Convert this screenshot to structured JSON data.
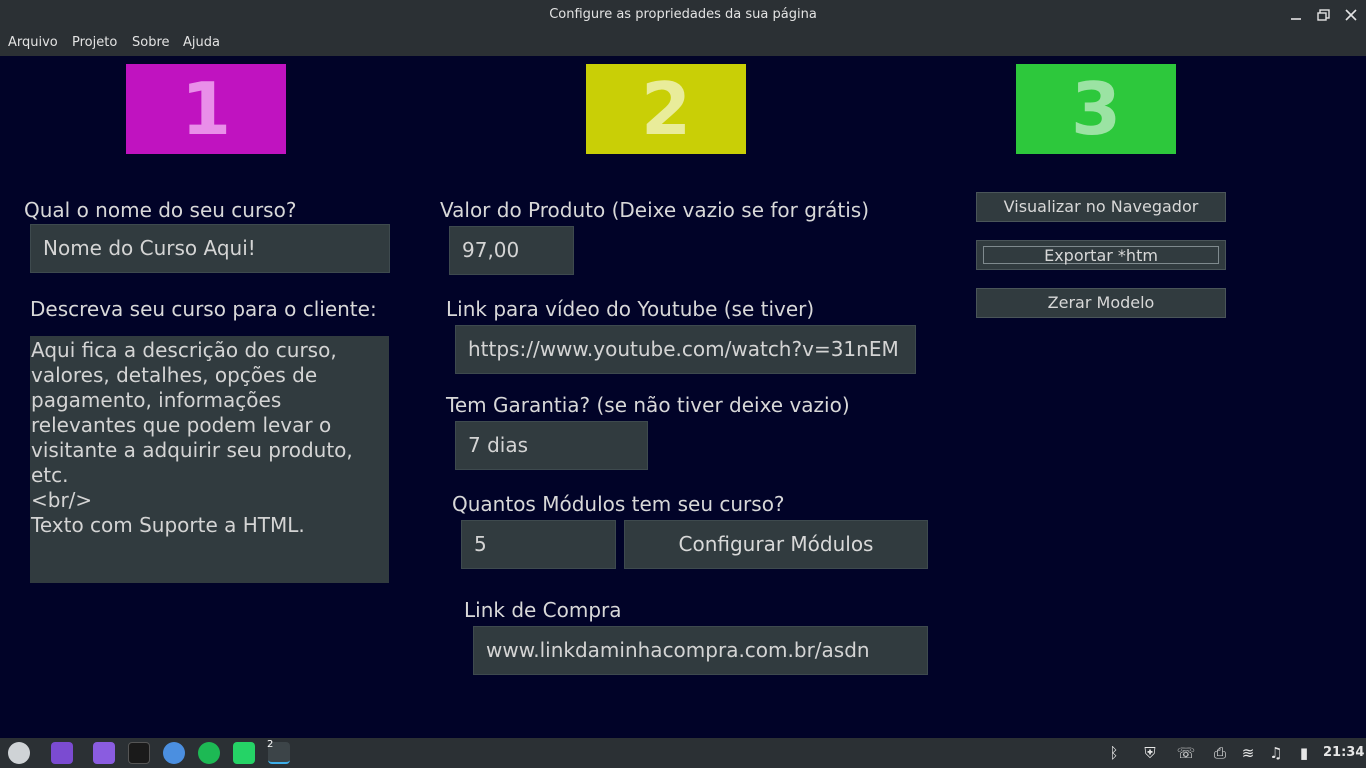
{
  "window": {
    "title": "Configure as propriedades da sua página"
  },
  "menu": [
    "Arquivo",
    "Projeto",
    "Sobre",
    "Ajuda"
  ],
  "steps": [
    {
      "number": "1",
      "bg": "#c013c0",
      "fg": "#e98fe9"
    },
    {
      "number": "2",
      "bg": "#c9cf06",
      "fg": "#e9ec9a"
    },
    {
      "number": "3",
      "bg": "#2dc83c",
      "fg": "#9be3a3"
    }
  ],
  "form": {
    "course_name_label": "Qual o nome do seu curso?",
    "course_name_value": "Nome do Curso Aqui!",
    "description_label": "Descreva seu curso para o cliente:",
    "description_value": "Aqui fica a descrição do curso,\nvalores, detalhes, opções de\npagamento, informações\nrelevantes que podem levar o\nvisitante a adquirir seu produto,\netc.\n<br/>\nTexto com Suporte a HTML.",
    "price_label": "Valor do Produto (Deixe vazio se for grátis)",
    "price_value": "97,00",
    "youtube_label": "Link para vídeo do Youtube (se tiver)",
    "youtube_value": "https://www.youtube.com/watch?v=31nEM",
    "guarantee_label": "Tem Garantia? (se não tiver deixe vazio)",
    "guarantee_value": "7 dias",
    "modules_label": "Quantos Módulos tem seu curso?",
    "modules_value": "5",
    "configure_modules_button": "Configurar Módulos",
    "purchase_link_label": "Link de Compra",
    "purchase_link_value": "www.linkdaminhacompra.com.br/asdn"
  },
  "actions": {
    "preview": "Visualizar no Navegador",
    "export": "Exportar *htm",
    "reset": "Zerar Modelo"
  },
  "taskbar": {
    "badge": "2",
    "clock": "21:34"
  },
  "colors": {
    "background": "#010328",
    "field": "#313b3f",
    "bar": "#2b3034"
  }
}
